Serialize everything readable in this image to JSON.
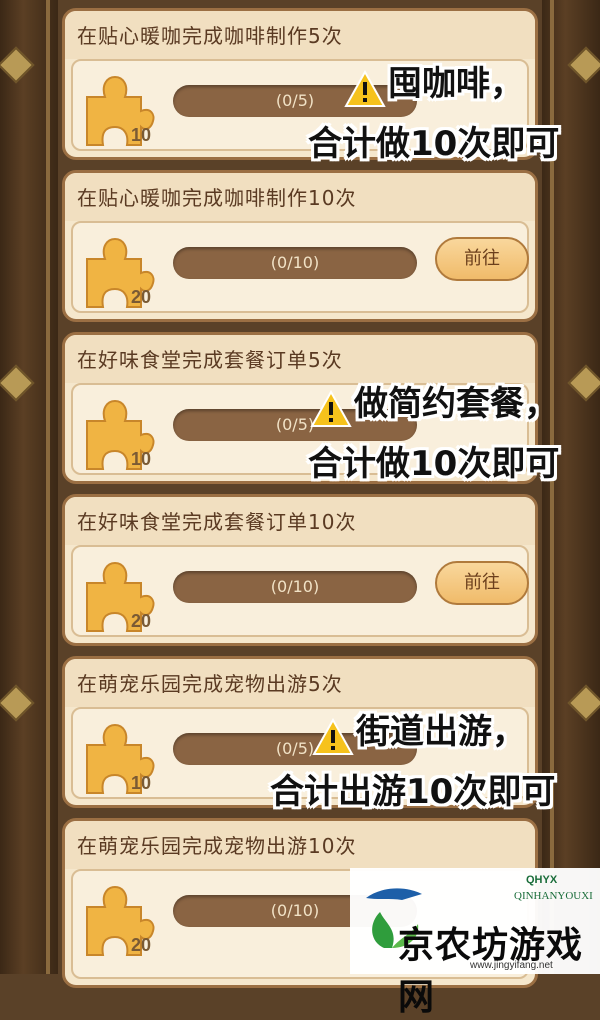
{
  "tasks": [
    {
      "title": "在贴心暖咖完成咖啡制作5次",
      "reward": "10",
      "progress": "(0/5)",
      "button": ""
    },
    {
      "title": "在贴心暖咖完成咖啡制作10次",
      "reward": "20",
      "progress": "(0/10)",
      "button": "前往"
    },
    {
      "title": "在好味食堂完成套餐订单5次",
      "reward": "10",
      "progress": "(0/5)",
      "button": ""
    },
    {
      "title": "在好味食堂完成套餐订单10次",
      "reward": "20",
      "progress": "(0/10)",
      "button": "前往"
    },
    {
      "title": "在萌宠乐园完成宠物出游5次",
      "reward": "10",
      "progress": "(0/5)",
      "button": ""
    },
    {
      "title": "在萌宠乐园完成宠物出游10次",
      "reward": "20",
      "progress": "(0/10)",
      "button": ""
    }
  ],
  "annotations": [
    {
      "line1": "囤咖啡，",
      "line2": "合计做10次即可"
    },
    {
      "line1": "做简约套餐，",
      "line2": "合计做10次即可"
    },
    {
      "line1": "街道出游，",
      "line2": "合计出游10次即可"
    }
  ],
  "watermark": {
    "brand": "QHYX",
    "sub": "QINHANYOUXI",
    "name": "京农坊游戏网",
    "url": "www.jingyifang.net"
  },
  "colors": {
    "card_bg": "#f5e7cc",
    "card_border": "#9b6f43",
    "progress_bar": "#8a6443",
    "button": "#f0bb6a",
    "puzzle": "#f0b443"
  },
  "icons": {
    "reward": "puzzle-piece-icon",
    "warning": "warning-icon"
  }
}
